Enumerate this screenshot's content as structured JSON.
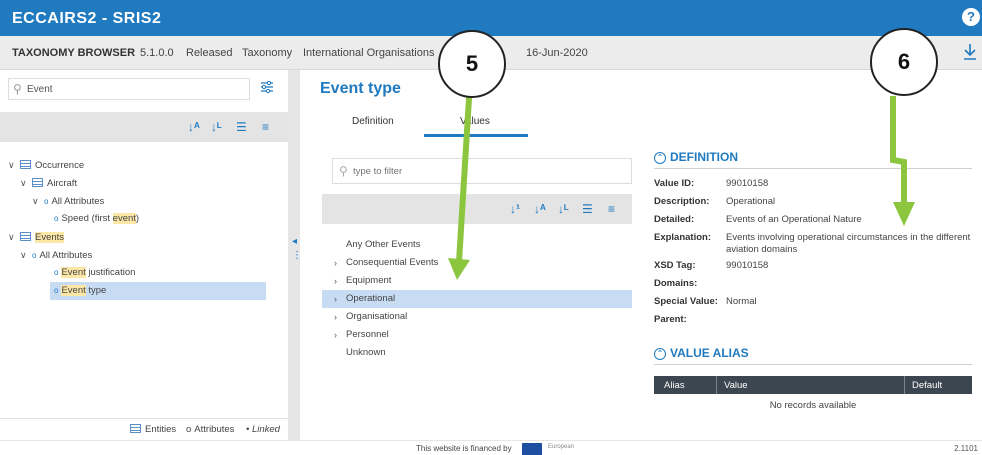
{
  "app": {
    "brand": "ECCAIRS2 - SRIS2",
    "help_label": "?"
  },
  "infobar": {
    "title": "TAXONOMY BROWSER",
    "version": "5.1.0.0",
    "status": "Released",
    "type": "Taxonomy",
    "organisation": "International Organisations",
    "date": "16-Jun-2020"
  },
  "left": {
    "search_value": "Event",
    "tree": [
      {
        "label": "Occurrence",
        "kind": "entity"
      },
      {
        "label": "Aircraft",
        "kind": "entity"
      },
      {
        "label": "All Attributes",
        "kind": "attr-group"
      },
      {
        "label": "Speed (first ",
        "highlight": "event",
        "suffix": ")",
        "kind": "attr"
      },
      {
        "label": "Events",
        "kind": "entity"
      },
      {
        "label": "All Attributes",
        "kind": "attr-group"
      },
      {
        "highlight": "Event",
        "label": " justification",
        "kind": "attr"
      },
      {
        "highlight": "Event",
        "label": " type",
        "kind": "attr"
      }
    ],
    "legend": {
      "entities": "Entities",
      "attributes": "Attributes",
      "linked": "Linked"
    }
  },
  "main": {
    "title": "Event type",
    "tabs": [
      {
        "label": "Definition"
      },
      {
        "label": "Values"
      }
    ],
    "filter_placeholder": "type to filter",
    "values": [
      {
        "label": "Any Other Events",
        "expandable": false
      },
      {
        "label": "Consequential Events",
        "expandable": true
      },
      {
        "label": "Equipment",
        "expandable": true
      },
      {
        "label": "Operational",
        "expandable": true,
        "selected": true
      },
      {
        "label": "Organisational",
        "expandable": true
      },
      {
        "label": "Personnel",
        "expandable": true
      },
      {
        "label": "Unknown",
        "expandable": false
      }
    ]
  },
  "definition": {
    "heading": "DEFINITION",
    "rows": [
      {
        "label": "Value ID:",
        "value": "99010158"
      },
      {
        "label": "Description:",
        "value": "Operational"
      },
      {
        "label": "Detailed:",
        "value": "Events of an Operational Nature"
      },
      {
        "label": "Explanation:",
        "value": "Events involving operational circumstances in the different aviation domains"
      },
      {
        "label": "XSD Tag:",
        "value": "99010158"
      },
      {
        "label": "Domains:",
        "value": ""
      },
      {
        "label": "Special Value:",
        "value": "Normal"
      },
      {
        "label": "Parent:",
        "value": ""
      }
    ]
  },
  "alias": {
    "heading": "VALUE ALIAS",
    "columns": [
      "Alias",
      "Value",
      "Default"
    ],
    "empty_text": "No records available"
  },
  "callouts": {
    "left": "5",
    "right": "6"
  },
  "footer": {
    "financed": "This website is financed by",
    "eu_text": "European",
    "version": "2.1101"
  },
  "colors": {
    "brand": "#1f7ac0",
    "arrow": "#8cc63f",
    "selection": "#c7dcf3",
    "highlight": "#fce7a6"
  }
}
